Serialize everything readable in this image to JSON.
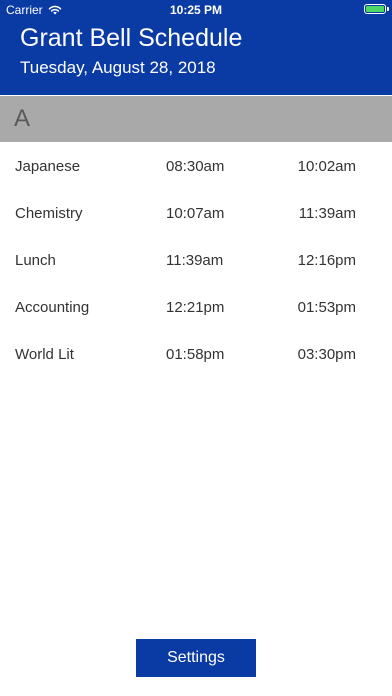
{
  "status_bar": {
    "carrier": "Carrier",
    "time": "10:25 PM",
    "battery_color": "#4cd964"
  },
  "header": {
    "title": "Grant Bell Schedule",
    "date": "Tuesday, August 28, 2018",
    "background_color": "#0a3aa4"
  },
  "section": {
    "label": "A"
  },
  "schedule": {
    "rows": [
      {
        "period": "Japanese",
        "start": "08:30am",
        "end": "10:02am"
      },
      {
        "period": "Chemistry",
        "start": "10:07am",
        "end": "11:39am"
      },
      {
        "period": "Lunch",
        "start": "11:39am",
        "end": "12:16pm"
      },
      {
        "period": "Accounting",
        "start": "12:21pm",
        "end": "01:53pm"
      },
      {
        "period": "World Lit",
        "start": "01:58pm",
        "end": "03:30pm"
      }
    ]
  },
  "footer": {
    "settings_label": "Settings"
  }
}
